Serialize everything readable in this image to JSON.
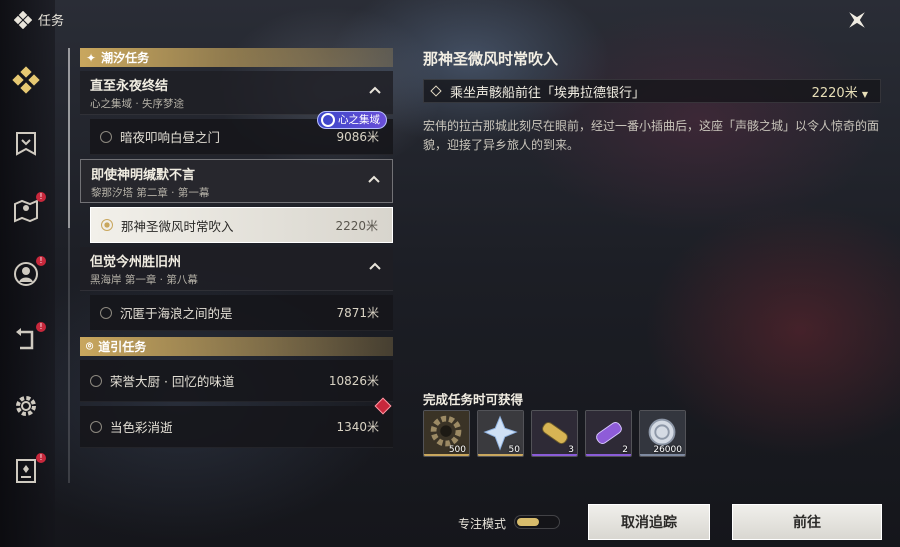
{
  "header": {
    "title": "任务"
  },
  "sidebar": {
    "items": [
      {
        "icon": "diamonds-icon",
        "badge": ""
      },
      {
        "icon": "banner-icon",
        "badge": ""
      },
      {
        "icon": "map-pin-icon",
        "badge": "!"
      },
      {
        "icon": "person-circle-icon",
        "badge": "!"
      },
      {
        "icon": "return-arrow-icon",
        "badge": "!"
      },
      {
        "icon": "gear-icon",
        "badge": ""
      },
      {
        "icon": "book-icon",
        "badge": "!"
      }
    ]
  },
  "quest_list": {
    "section_tide": "潮汐任务",
    "groups": [
      {
        "title": "直至永夜终结",
        "subtitle": "心之集域 · 失序梦途",
        "task": {
          "name": "暗夜叩响白昼之门",
          "distance": "9086米",
          "tag": "心之集域"
        }
      },
      {
        "title": "即使神明缄默不言",
        "subtitle": "黎那汐塔 第二章 · 第一幕",
        "task": {
          "name": "那神圣微风时常吹入",
          "distance": "2220米"
        }
      },
      {
        "title": "但觉今州胜旧州",
        "subtitle": "黑海岸 第一章 · 第八幕",
        "task": {
          "name": "沉匿于海浪之间的是",
          "distance": "7871米"
        }
      }
    ],
    "section_guide": "道引任务",
    "guide_tasks": [
      {
        "name": "荣誉大厨 · 回忆的味道",
        "distance": "10826米"
      },
      {
        "name": "当色彩消逝",
        "distance": "1340米"
      }
    ]
  },
  "detail": {
    "title": "那神圣微风时常吹入",
    "objective": "乘坐声骸船前往「埃弗拉德银行」",
    "objective_distance": "2220米",
    "description": "宏伟的拉古那城此刻尽在眼前，经过一番小插曲后，这座「声骸之城」以令人惊奇的面貌，迎接了异乡旅人的到来。",
    "rewards_title": "完成任务时可获得",
    "rewards": [
      {
        "icon": "gear-ring-icon",
        "qty": "500",
        "rarity_color": "#c9a75e"
      },
      {
        "icon": "crystal-icon",
        "qty": "50",
        "rarity_color": "#c9a75e"
      },
      {
        "icon": "gold-capsule-icon",
        "qty": "3",
        "rarity_color": "#8a5cd8"
      },
      {
        "icon": "purple-capsule-icon",
        "qty": "2",
        "rarity_color": "#8a5cd8"
      },
      {
        "icon": "shell-coin-icon",
        "qty": "26000",
        "rarity_color": "#7f8aa0"
      }
    ]
  },
  "footer": {
    "focus_mode": "专注模式",
    "cancel_track": "取消追踪",
    "go": "前往"
  }
}
